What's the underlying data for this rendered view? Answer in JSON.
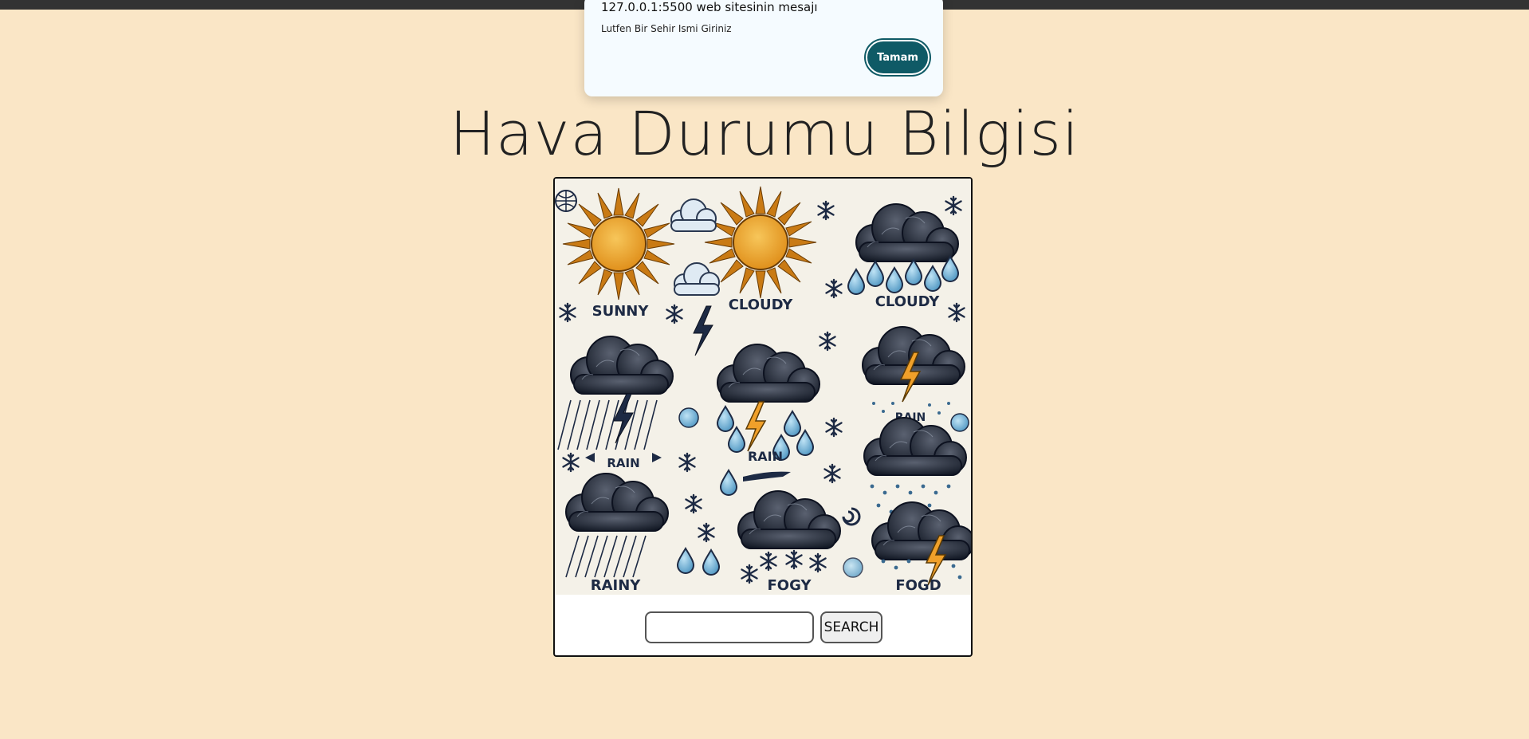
{
  "dialog": {
    "title": "127.0.0.1:5500 web sitesinin mesajı",
    "message": "Lutfen Bir Sehir Ismi Giriniz",
    "ok_label": "Tamam",
    "accent": "#0f5a66"
  },
  "page": {
    "title": "Hava Durumu Bilgisi",
    "background": "#fae6c6"
  },
  "weather_image": {
    "labels": {
      "sunny": "SUNNY",
      "cloudy_1": "CLOUDY",
      "cloudy_2": "CLOUDY",
      "rain_1": "RAIN",
      "rain_2": "RAIN",
      "rain_3": "RAIN",
      "rainy": "RAINY",
      "fogy": "FOGY",
      "fogd": "FOGD"
    }
  },
  "search": {
    "value": "",
    "button_label": "SEARCH"
  }
}
